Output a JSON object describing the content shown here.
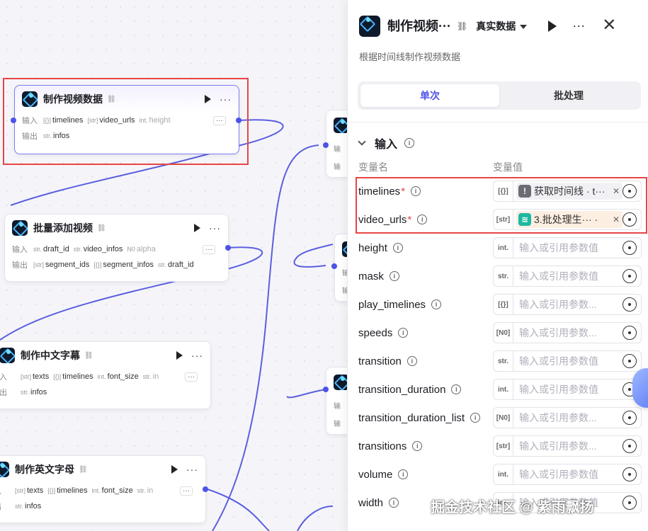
{
  "canvas": {
    "nodes": [
      {
        "title": "制作视频数据",
        "inputs_label": "输入",
        "outputs_label": "输出",
        "inputs": [
          {
            "type": "[{}]",
            "name": "timelines"
          },
          {
            "type": "[str]",
            "name": "video_urls"
          },
          {
            "type": "int.",
            "name": "height"
          }
        ],
        "outputs": [
          {
            "type": "str.",
            "name": "infos"
          }
        ]
      },
      {
        "title": "批量添加视频",
        "inputs_label": "输入",
        "outputs_label": "输出",
        "inputs": [
          {
            "type": "str.",
            "name": "draft_id"
          },
          {
            "type": "str.",
            "name": "video_infos"
          },
          {
            "type": "N0",
            "name": "alpha"
          }
        ],
        "outputs": [
          {
            "type": "[str]",
            "name": "segment_ids"
          },
          {
            "type": "[{}]",
            "name": "segment_infos"
          },
          {
            "type": "str.",
            "name": "draft_id"
          }
        ]
      },
      {
        "title": "制作中文字幕",
        "inputs_label": "入",
        "outputs_label": "出",
        "inputs": [
          {
            "type": "[str]",
            "name": "texts"
          },
          {
            "type": "[{}]",
            "name": "timelines"
          },
          {
            "type": "int.",
            "name": "font_size"
          },
          {
            "type": "str.",
            "name": "in"
          }
        ],
        "outputs": [
          {
            "type": "str.",
            "name": "infos"
          }
        ]
      },
      {
        "title": "制作英文字母",
        "inputs_label": "入",
        "outputs_label": "出",
        "inputs": [
          {
            "type": "[str]",
            "name": "texts"
          },
          {
            "type": "[{}]",
            "name": "timelines"
          },
          {
            "type": "int.",
            "name": "font_size"
          },
          {
            "type": "str.",
            "name": "in"
          }
        ],
        "outputs": [
          {
            "type": "str.",
            "name": "infos"
          }
        ]
      }
    ],
    "partial_labels": {
      "in": "输",
      "out": "输"
    },
    "more_btn": "···"
  },
  "panel": {
    "title": "制作视频···",
    "mode": "真实数据",
    "description": "根据时间线制作视频数据",
    "tabs": [
      "单次",
      "批处理"
    ],
    "active_tab": "单次",
    "section": "输入",
    "col_name": "变量名",
    "col_value": "变量值",
    "placeholder": "输入或引用参数值",
    "placeholder_short": "输入或引用参数...",
    "params": [
      {
        "name": "timelines",
        "required": true,
        "type": "[{}]",
        "ref": "获取时间线 · t···",
        "ref_color": "#6b6b72",
        "ref_icon": "!"
      },
      {
        "name": "video_urls",
        "required": true,
        "type": "[str]",
        "ref": "3.批处理生···  ·",
        "ref_color": "#1bb9a0",
        "ref_icon": "≋"
      },
      {
        "name": "height",
        "required": false,
        "type": "int.",
        "ph": "long"
      },
      {
        "name": "mask",
        "required": false,
        "type": "str.",
        "ph": "long"
      },
      {
        "name": "play_timelines",
        "required": false,
        "type": "[{}]",
        "ph": "short"
      },
      {
        "name": "speeds",
        "required": false,
        "type": "[N0]",
        "ph": "short"
      },
      {
        "name": "transition",
        "required": false,
        "type": "str.",
        "ph": "long"
      },
      {
        "name": "transition_duration",
        "required": false,
        "type": "int.",
        "ph": "long"
      },
      {
        "name": "transition_duration_list",
        "required": false,
        "type": "[N0]",
        "ph": "short"
      },
      {
        "name": "transitions",
        "required": false,
        "type": "[str]",
        "ph": "short"
      },
      {
        "name": "volume",
        "required": false,
        "type": "int.",
        "ph": "long"
      },
      {
        "name": "width",
        "required": false,
        "type": "int.",
        "ph": "long"
      }
    ]
  },
  "watermark": "掘金技术社区 @ 紫雨飘扬",
  "colors": {
    "accent": "#4d53e8",
    "highlight": "#e84545"
  }
}
